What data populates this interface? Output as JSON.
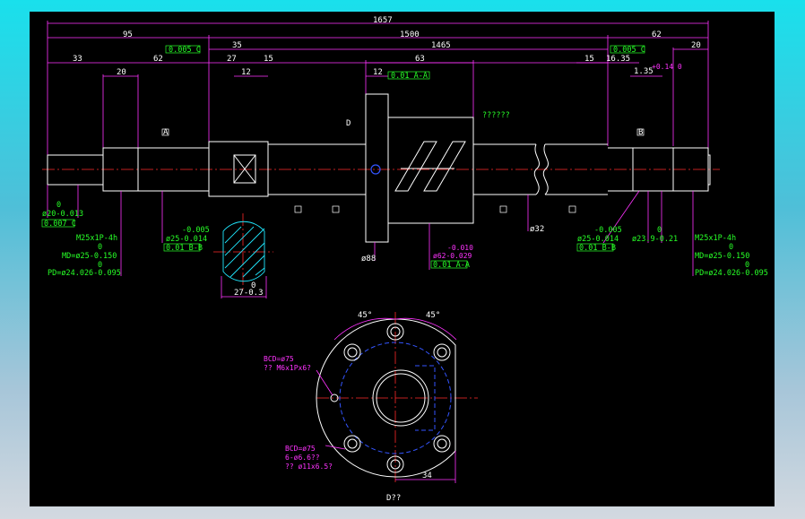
{
  "overall": {
    "total": "1657",
    "left": "95",
    "middle": "1500",
    "right": "62"
  },
  "dims_top": {
    "d33": "33",
    "d20a": "20",
    "d62": "62",
    "d35": "35",
    "d27": "27",
    "d12a": "12",
    "d15a": "15",
    "d1465": "1465",
    "d12b": "12",
    "d63": "63",
    "d15b": "15",
    "d1635": "16.35",
    "d20b": "20",
    "d135": "1.35",
    "d135tol": "+0.14\n0"
  },
  "frames": {
    "f1": "0.005 C",
    "f2": "0.005 C",
    "f3": "0.01 A-A",
    "f4": "0.007 C"
  },
  "labels": {
    "letter_d": "D",
    "question": "??????",
    "dia20a": "0",
    "dia20b": "ø20-0.013",
    "left_thread1": "M25x1P-4h",
    "left_thread2": "0",
    "left_thread3": "MD=ø25-0.150",
    "left_thread4": "0",
    "left_thread5": "PD=ø24.026-0.095",
    "dia25a": "-0.005",
    "dia25b": "ø25-0.014",
    "frame_ab": "0.01 B-B",
    "dia88": "ø88",
    "dia62a": "-0.010",
    "dia62b": "ø62-0.029",
    "frame_aa": "0.01 A-A",
    "dia32": "ø32",
    "dia25c": "-0.005",
    "dia25d": "ø25-0.014",
    "frame_bb": "0.01 B-B",
    "dia239a": "0",
    "dia239b": "ø23.9-0.21",
    "right_thread1": "M25x1P-4h",
    "right_thread2": "0",
    "right_thread3": "MD=ø25-0.150",
    "right_thread4": "0",
    "right_thread5": "PD=ø24.026-0.095",
    "section_dim": "27-0.3",
    "section_tol": "0",
    "angle_left": "45°",
    "angle_right": "45°",
    "bcd1": "BCD=ø75",
    "bcd1b": "?? M6x1Px6?",
    "bcd2": "BCD=ø75",
    "bcd2b": "6-ø6.6??",
    "bcd2c": "?? ø11x6.5?",
    "d34": "34",
    "view_label": "D??"
  },
  "datum_letters": {
    "a": "A",
    "b": "B",
    "c": "C"
  },
  "colors": {
    "background": "#000000",
    "outline": "#ffffff",
    "dimension": "#ff33ff",
    "note": "#27ff27",
    "center": "#ff2a2a",
    "hidden": "#3355ff",
    "hatch": "#20e8ff"
  }
}
